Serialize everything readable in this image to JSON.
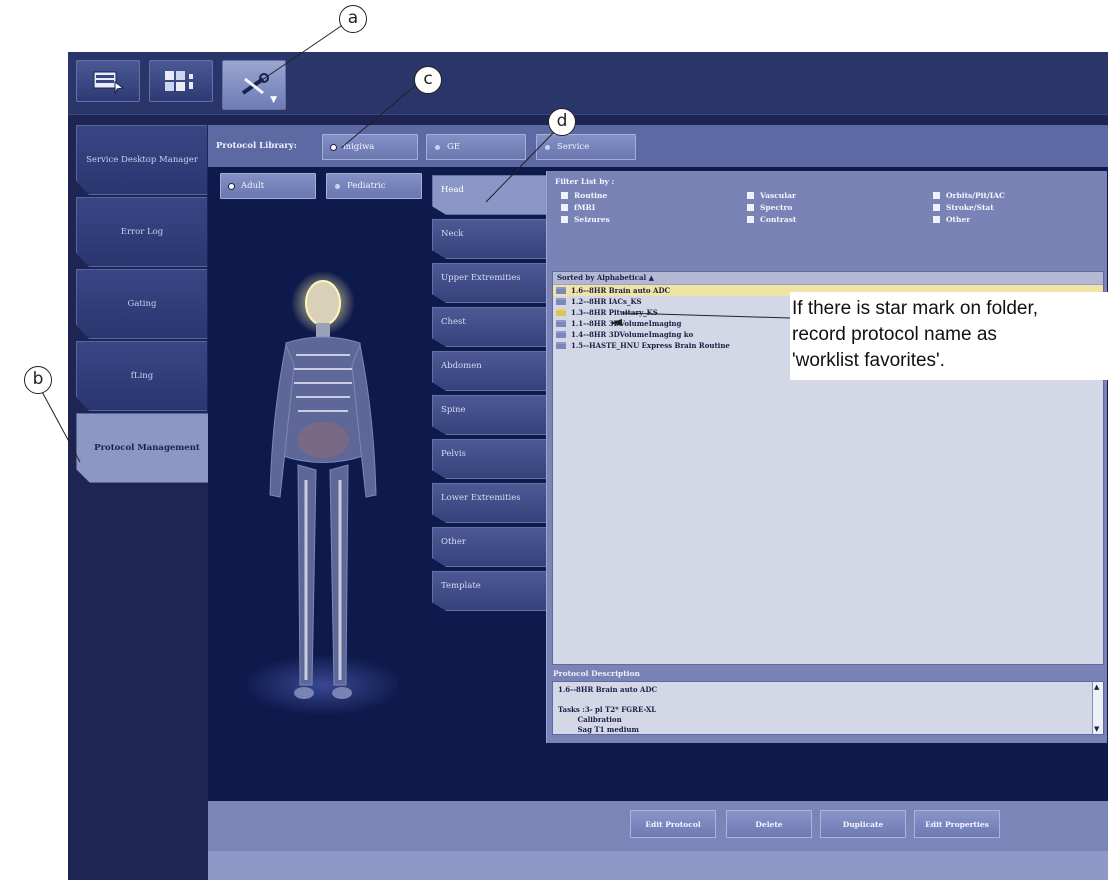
{
  "callouts": {
    "a": "a",
    "b": "b",
    "c": "c",
    "d": "d"
  },
  "toolbar": {
    "buttons": [
      {
        "icon": "scan-monitor-icon"
      },
      {
        "icon": "image-viewer-icon"
      },
      {
        "icon": "tools-icon",
        "active": true
      }
    ]
  },
  "nav": {
    "items": [
      {
        "label": "Service Desktop Manager"
      },
      {
        "label": "Error Log"
      },
      {
        "label": "Gating"
      },
      {
        "label": "fLing"
      },
      {
        "label": "Protocol Management",
        "active": true
      }
    ]
  },
  "library": {
    "label": "Protocol Library:",
    "options": [
      {
        "label": "migiwa",
        "selected": true
      },
      {
        "label": "GE",
        "selected": false
      },
      {
        "label": "Service",
        "selected": false
      }
    ]
  },
  "patient": {
    "options": [
      {
        "label": "Adult",
        "selected": true
      },
      {
        "label": "Pediatric",
        "selected": false
      }
    ]
  },
  "anatomy": {
    "tabs": [
      {
        "label": "Head",
        "active": true
      },
      {
        "label": "Neck"
      },
      {
        "label": "Upper Extremities"
      },
      {
        "label": "Chest"
      },
      {
        "label": "Abdomen"
      },
      {
        "label": "Spine"
      },
      {
        "label": "Pelvis"
      },
      {
        "label": "Lower Extremities"
      },
      {
        "label": "Other"
      },
      {
        "label": "Template"
      }
    ]
  },
  "filter": {
    "label": "Filter List by :",
    "items": [
      "Routine",
      "fMRI",
      "Seizures",
      "Vascular",
      "Spectro",
      "Contrast",
      "Orbits/Pit/IAC",
      "Stroke/Stat",
      "Other"
    ]
  },
  "protocols": {
    "header": "Sorted by Alphabetical ▲",
    "rows": [
      {
        "name": "1.6--8HR Brain auto ADC",
        "selected": true,
        "star": false
      },
      {
        "name": "1.2--8HR IACs_KS",
        "selected": false,
        "star": false
      },
      {
        "name": "1.3--8HR Pituitary_KS",
        "selected": false,
        "star": true
      },
      {
        "name": "1.1--8HR 3DVolumeImaging",
        "selected": false,
        "star": false
      },
      {
        "name": "1.4--8HR 3DVolumeImaging ko",
        "selected": false,
        "star": false
      },
      {
        "name": "1.5--HASTE_HNU Express Brain Routine",
        "selected": false,
        "star": false
      }
    ]
  },
  "description": {
    "label": "Protocol Description",
    "text": "1.6--8HR Brain auto ADC\n\nTasks :3- pl T2* FGRE-XL\n        Calibration\n        Sag T1 medium"
  },
  "actions": {
    "edit_protocol": "Edit Protocol",
    "delete": "Delete",
    "duplicate": "Duplicate",
    "edit_properties": "Edit Properties"
  },
  "annotation": {
    "line1": "If there is star mark on folder,",
    "line2": "record protocol name as",
    "line3": "'worklist favorites'."
  }
}
